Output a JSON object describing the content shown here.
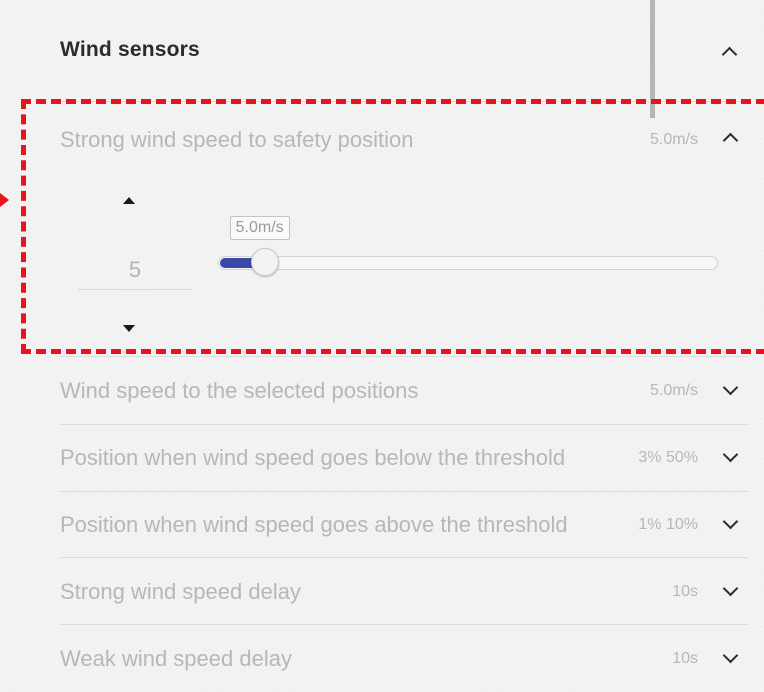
{
  "panel": {
    "title": "Wind sensors"
  },
  "expanded_setting": {
    "label": "Strong wind speed to safety position",
    "value": "5.0m/s",
    "stepper_value": "5",
    "slider_tooltip": "5.0m/s",
    "slider_fraction": 0.09
  },
  "settings": [
    {
      "label": "Wind speed to the selected positions",
      "value": "5.0m/s"
    },
    {
      "label": "Position when wind speed goes below the threshold",
      "value": "3% 50%"
    },
    {
      "label": "Position when wind speed goes above the threshold",
      "value": "1% 10%"
    },
    {
      "label": "Strong wind speed delay",
      "value": "10s"
    },
    {
      "label": "Weak wind speed delay",
      "value": "10s"
    }
  ],
  "icons": {
    "collapse": "chevron-up-icon",
    "expand": "chevron-down-icon",
    "increment": "triangle-up-icon",
    "decrement": "triangle-down-icon"
  },
  "colors": {
    "accent": "#3a49a8",
    "highlight": "#e8141c",
    "muted_text": "#b7b7b7",
    "title_text": "#2b2b2b"
  }
}
